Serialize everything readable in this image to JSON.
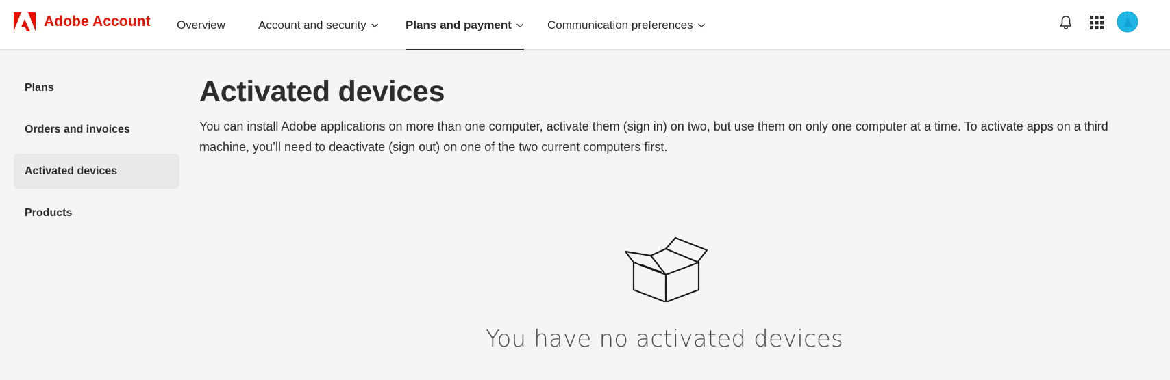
{
  "header": {
    "brand_name": "Adobe Account",
    "nav": [
      {
        "label": "Overview",
        "has_dropdown": false,
        "active": false
      },
      {
        "label": "Account and security",
        "has_dropdown": true,
        "active": false
      },
      {
        "label": "Plans and payment",
        "has_dropdown": true,
        "active": true
      },
      {
        "label": "Communication preferences",
        "has_dropdown": true,
        "active": false
      }
    ],
    "icons": [
      "bell-icon",
      "apps-grid-icon",
      "avatar"
    ]
  },
  "sidebar": {
    "items": [
      {
        "label": "Plans",
        "active": false
      },
      {
        "label": "Orders and invoices",
        "active": false
      },
      {
        "label": "Activated devices",
        "active": true
      },
      {
        "label": "Products",
        "active": false
      }
    ]
  },
  "main": {
    "title": "Activated devices",
    "description": "You can install Adobe applications on more than one computer, activate them (sign in) on two, but use them on only one computer at a time. To activate apps on a third machine, you’ll need to deactivate (sign out) on one of the two current computers first.",
    "empty_icon": "open-box-icon",
    "empty_message": "You have no activated devices"
  },
  "colors": {
    "brand": "#eb1000",
    "page_background": "#f5f5f5",
    "header_background": "#ffffff",
    "sidebar_active": "#e9e9e9",
    "avatar": "#1fb6e6"
  }
}
